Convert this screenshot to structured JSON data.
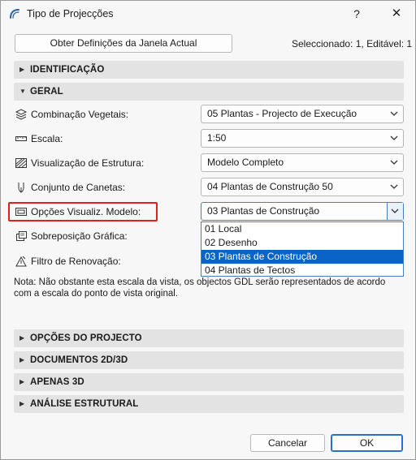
{
  "window": {
    "title": "Tipo de Projecções",
    "help_label": "?",
    "close_label": "✕"
  },
  "toolbar": {
    "get_settings_label": "Obter Definições da Janela Actual",
    "selection_status": "Seleccionado: 1, Editável: 1"
  },
  "panels": {
    "identificacao": "IDENTIFICAÇÃO",
    "geral": "GERAL",
    "opcoes_projecto": "OPÇÕES DO PROJECTO",
    "documentos": "DOCUMENTOS 2D/3D",
    "apenas_3d": "APENAS 3D",
    "analise": "ANÁLISE ESTRUTURAL"
  },
  "rows": [
    {
      "label": "Combinação Vegetais:",
      "value": "05 Plantas - Projecto de Execução",
      "icon": "layer-combination-icon"
    },
    {
      "label": "Escala:",
      "value": "1:50",
      "icon": "scale-ruler-icon"
    },
    {
      "label": "Visualização de Estrutura:",
      "value": "Modelo Completo",
      "icon": "structure-display-icon"
    },
    {
      "label": "Conjunto de Canetas:",
      "value": "04 Plantas de Construção 50",
      "icon": "pen-set-icon"
    },
    {
      "label": "Opções Visualiz. Modelo:",
      "value": "03 Plantas de Construção",
      "icon": "model-view-options-icon"
    },
    {
      "label": "Sobreposição Gráfica:",
      "icon": "graphic-override-icon"
    },
    {
      "label": "Filtro de Renovação:",
      "icon": "renovation-filter-icon"
    }
  ],
  "dropdown_options": [
    "01 Local",
    "02 Desenho",
    "03 Plantas de Construção",
    "04 Plantas de Tectos"
  ],
  "note": "Nota: Não obstante esta escala da vista, os objectos GDL serão representados de acordo com a escala do ponto de vista original.",
  "footer": {
    "cancel_label": "Cancelar",
    "ok_label": "OK"
  },
  "colors": {
    "highlight_border": "#e01f1f",
    "selected_item": "#0a64c8",
    "panel_header": "#e3e3e3"
  }
}
